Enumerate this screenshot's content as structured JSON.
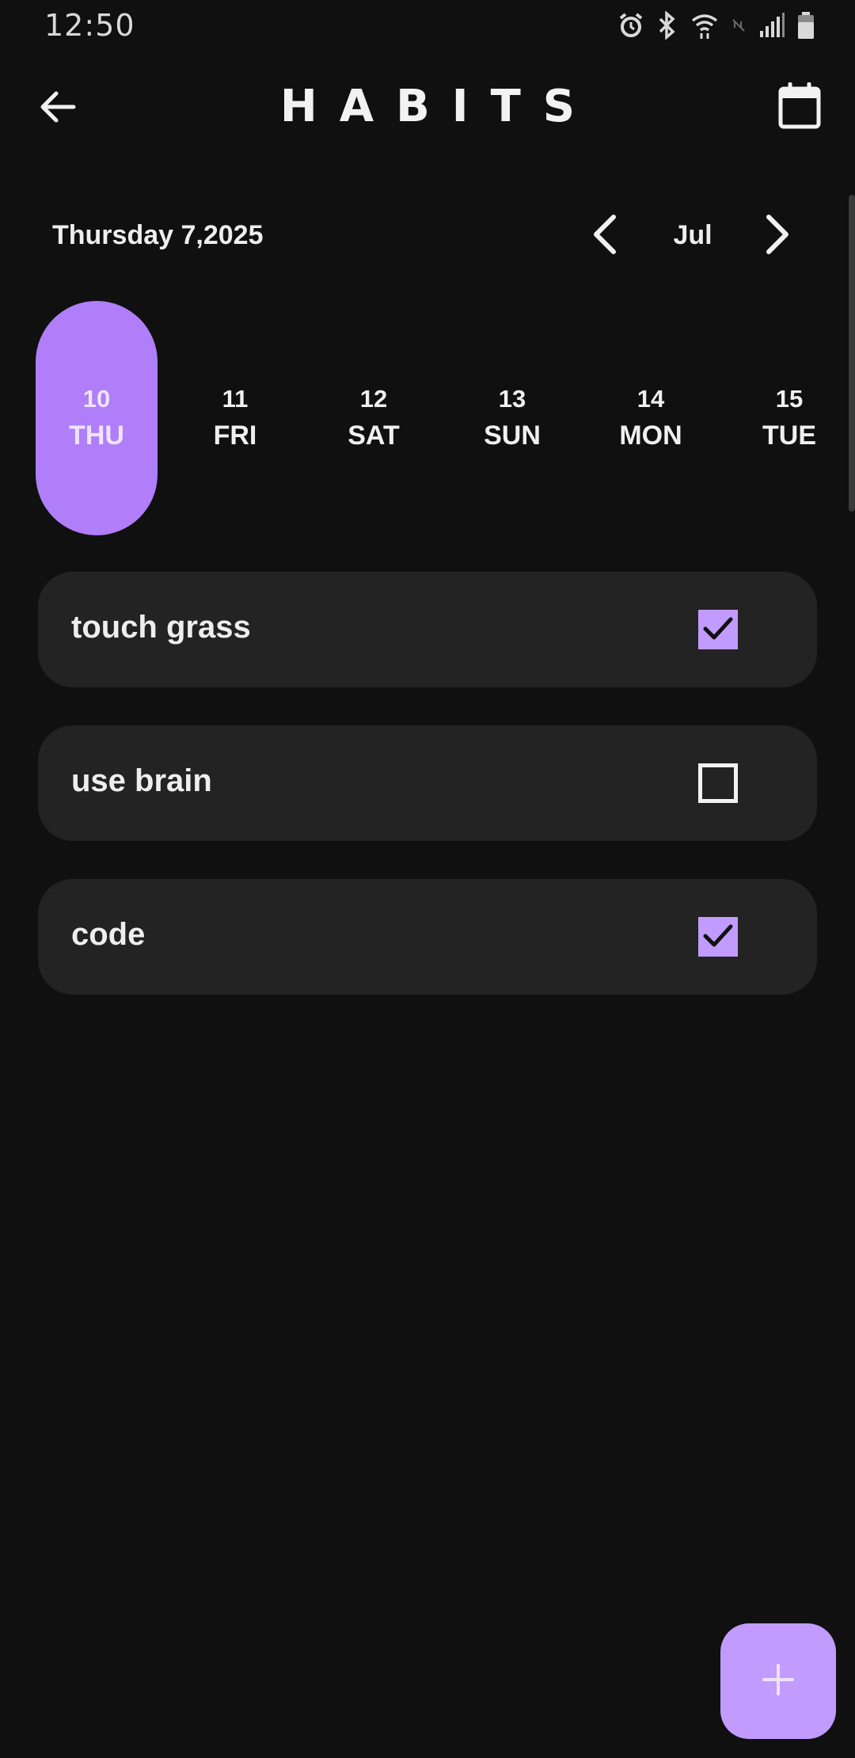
{
  "status_bar": {
    "time": "12:50",
    "icons": [
      "alarm-icon",
      "bluetooth-icon",
      "wifi-icon",
      "nfc-icon",
      "signal-icon",
      "battery-icon"
    ]
  },
  "header": {
    "title": "HABITS",
    "back_icon": "arrow-left-icon",
    "calendar_icon": "calendar-icon"
  },
  "date_nav": {
    "date_label": "Thursday 7,2025",
    "month": "Jul",
    "prev_icon": "chevron-left-icon",
    "next_icon": "chevron-right-icon"
  },
  "days": [
    {
      "num": "10",
      "name": "THU",
      "selected": true
    },
    {
      "num": "11",
      "name": "FRI",
      "selected": false
    },
    {
      "num": "12",
      "name": "SAT",
      "selected": false
    },
    {
      "num": "13",
      "name": "SUN",
      "selected": false
    },
    {
      "num": "14",
      "name": "MON",
      "selected": false
    },
    {
      "num": "15",
      "name": "TUE",
      "selected": false
    }
  ],
  "habits": [
    {
      "name": "touch grass",
      "checked": true
    },
    {
      "name": "use brain",
      "checked": false
    },
    {
      "name": "code",
      "checked": true
    }
  ],
  "fab": {
    "icon": "plus-icon"
  },
  "colors": {
    "background": "#101011",
    "card": "#232324",
    "accent": "#b07ef8",
    "accent_light": "#c29bff"
  }
}
